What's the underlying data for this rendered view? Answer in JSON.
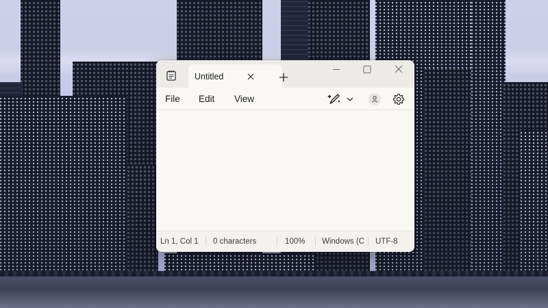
{
  "window": {
    "tab_title": "Untitled"
  },
  "menu": {
    "file": "File",
    "edit": "Edit",
    "view": "View"
  },
  "icons": {
    "app": "notepad-icon",
    "tab_close": "close-icon",
    "new_tab": "plus-icon",
    "minimize": "minimize-icon",
    "maximize": "maximize-icon",
    "close": "close-icon",
    "copilot": "copilot-pen-icon",
    "dropdown": "chevron-down-icon",
    "account": "account-icon",
    "settings": "gear-icon"
  },
  "editor": {
    "content": ""
  },
  "status": {
    "position": "Ln 1, Col 1",
    "characters": "0 characters",
    "zoom": "100%",
    "line_ending": "Windows (C",
    "encoding": "UTF-8"
  },
  "colors": {
    "window_bg": "#f9f8f5",
    "titlebar_bg": "#ecebe8",
    "text": "#1c1c1c"
  }
}
